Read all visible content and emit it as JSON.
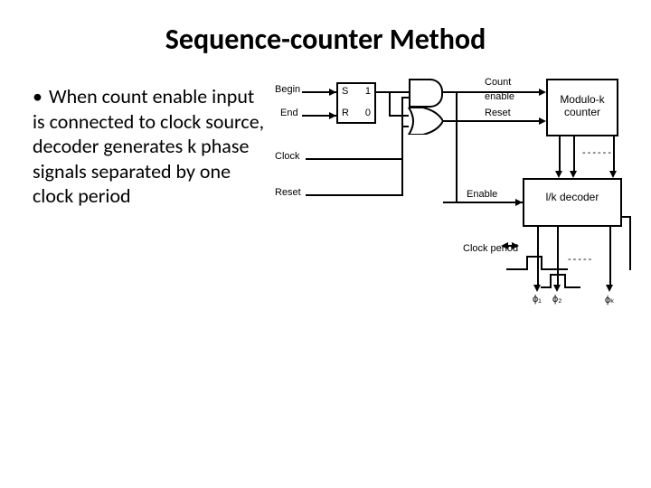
{
  "title": "Sequence-counter Method",
  "bullet_text": "When count enable input is connected to clock source, decoder generates k phase signals separated by one clock period",
  "diagram": {
    "inputs": {
      "begin": "Begin",
      "end": "End",
      "clock": "Clock",
      "reset": "Reset"
    },
    "sr_latch": {
      "s": "S",
      "r": "R",
      "out1": "1",
      "out0": "0"
    },
    "signals": {
      "count": "Count",
      "enable": "enable",
      "reset": "Reset",
      "enable2": "Enable"
    },
    "blocks": {
      "counter": "Modulo-k counter",
      "decoder": "l/k decoder"
    },
    "outputs": {
      "clock_period": "Clock period",
      "phi1": "ϕ₁",
      "phi2": "ϕ₂",
      "phik": "ϕₖ"
    }
  }
}
